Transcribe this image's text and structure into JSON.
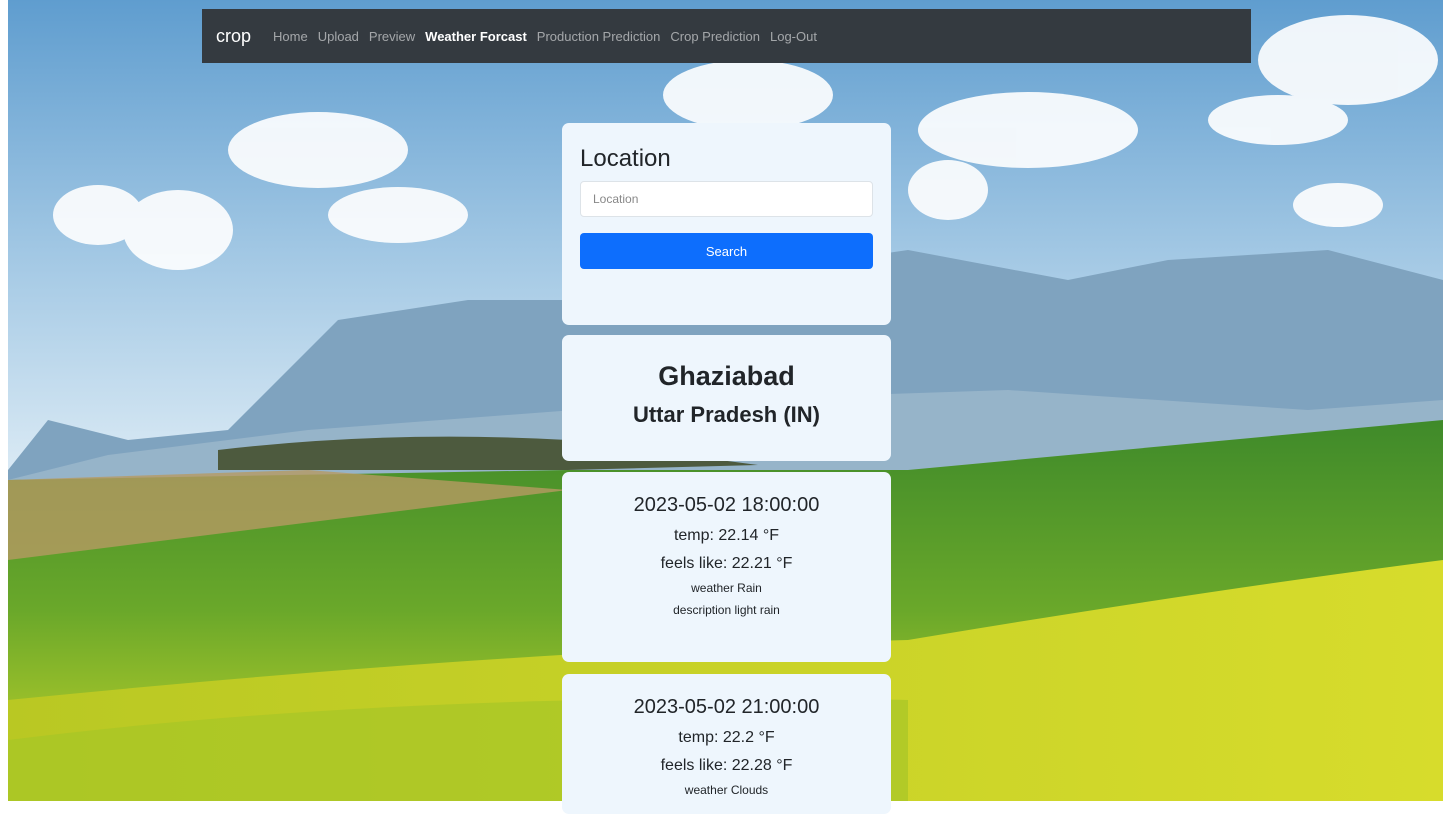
{
  "navbar": {
    "brand": "crop",
    "links": [
      {
        "label": "Home"
      },
      {
        "label": "Upload"
      },
      {
        "label": "Preview"
      },
      {
        "label": "Weather Forcast",
        "active": true
      },
      {
        "label": "Production Prediction"
      },
      {
        "label": "Crop Prediction"
      },
      {
        "label": "Log-Out"
      }
    ]
  },
  "search": {
    "title": "Location",
    "placeholder": "Location",
    "value": "",
    "button_label": "Search"
  },
  "location": {
    "city": "Ghaziabad",
    "region": "Uttar Pradesh (IN)"
  },
  "forecasts": [
    {
      "time": "2023-05-02 18:00:00",
      "temp": "temp: 22.14 °F",
      "feels_like": "feels like: 22.21 °F",
      "weather": "weather Rain",
      "description": "description light rain"
    },
    {
      "time": "2023-05-02 21:00:00",
      "temp": "temp: 22.2 °F",
      "feels_like": "feels like: 22.28 °F",
      "weather": "weather Clouds"
    }
  ],
  "colors": {
    "navbar_bg": "#343a40",
    "card_bg": "#eef6fd",
    "primary": "#0d6efd"
  }
}
